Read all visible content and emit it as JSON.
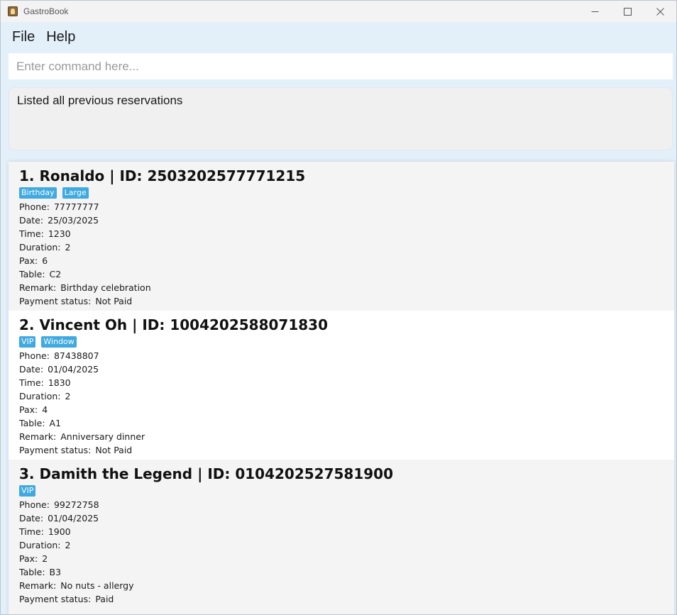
{
  "window": {
    "title": "GastroBook",
    "controls": {
      "minimize": "minimize-icon",
      "maximize": "maximize-icon",
      "close": "close-icon"
    }
  },
  "menu": {
    "file": "File",
    "help": "Help"
  },
  "command": {
    "placeholder": "Enter command here...",
    "value": ""
  },
  "result": {
    "text": "Listed all previous reservations"
  },
  "labels": {
    "phone": "Phone:",
    "date": "Date:",
    "time": "Time:",
    "duration": "Duration:",
    "pax": "Pax:",
    "table": "Table:",
    "remark": "Remark:",
    "payment": "Payment status:"
  },
  "colors": {
    "tag": "#3fa9e0",
    "background": "#e3f0fa"
  },
  "reservations": [
    {
      "title": "1. Ronaldo | ID: 2503202577771215",
      "tags": [
        "Birthday",
        "Large"
      ],
      "phone": "77777777",
      "date": "25/03/2025",
      "time": "1230",
      "duration": "2",
      "pax": "6",
      "table": "C2",
      "remark": "Birthday celebration",
      "payment": "Not Paid"
    },
    {
      "title": "2. Vincent Oh | ID: 1004202588071830",
      "tags": [
        "VIP",
        "Window"
      ],
      "phone": "87438807",
      "date": "01/04/2025",
      "time": "1830",
      "duration": "2",
      "pax": "4",
      "table": "A1",
      "remark": "Anniversary dinner",
      "payment": "Not Paid"
    },
    {
      "title": "3. Damith the Legend | ID: 0104202527581900",
      "tags": [
        "VIP"
      ],
      "phone": "99272758",
      "date": "01/04/2025",
      "time": "1900",
      "duration": "2",
      "pax": "2",
      "table": "B3",
      "remark": "No nuts - allergy",
      "payment": "Paid"
    }
  ]
}
